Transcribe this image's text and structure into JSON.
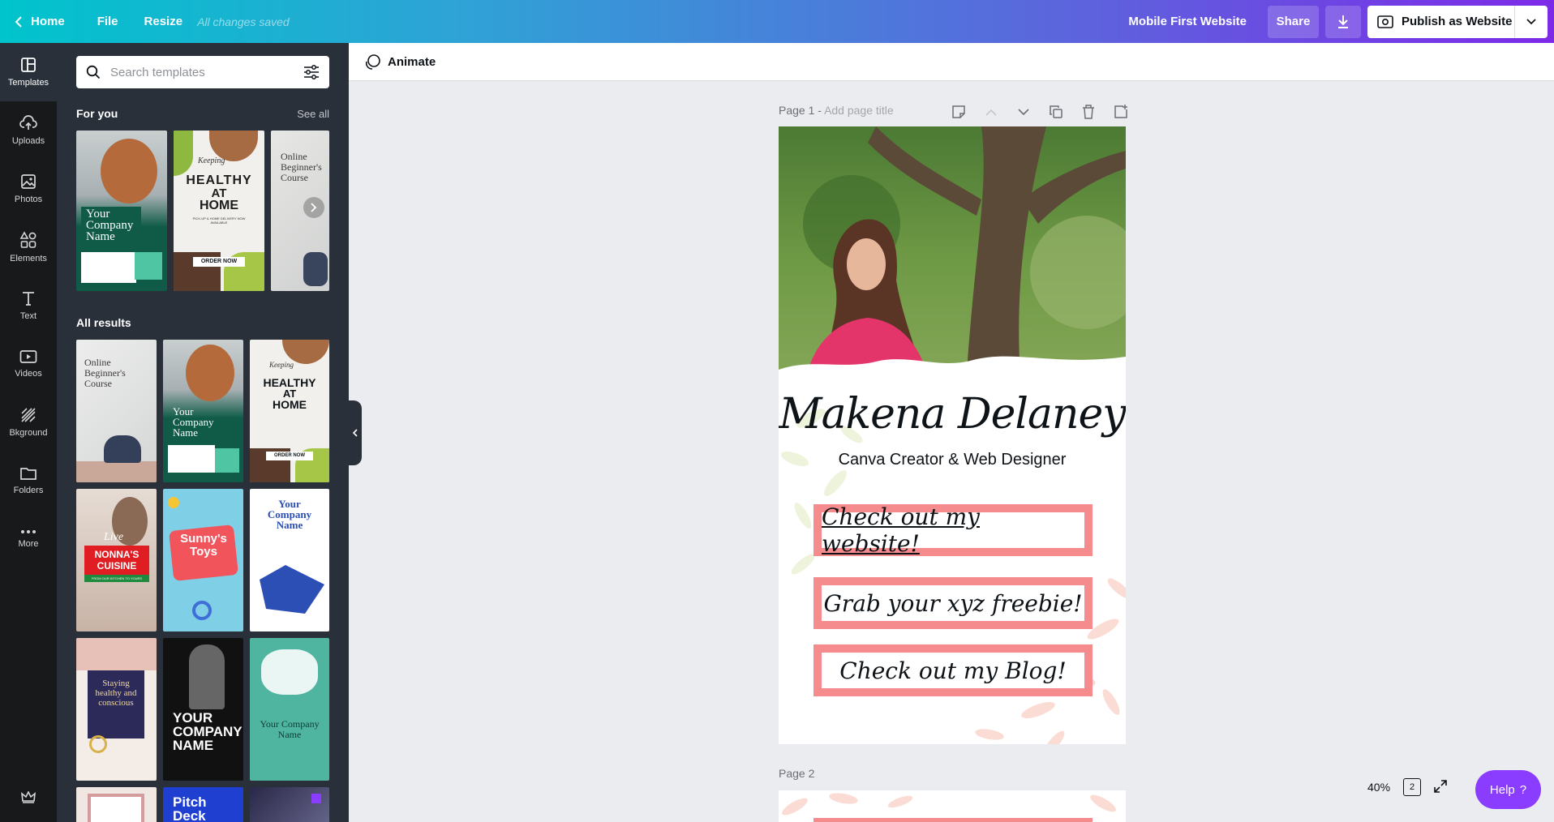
{
  "topbar": {
    "home_label": "Home",
    "file_label": "File",
    "resize_label": "Resize",
    "saved_status": "All changes saved",
    "design_title": "Mobile First Website",
    "share_label": "Share",
    "publish_label": "Publish as Website"
  },
  "rail": {
    "items": [
      {
        "label": "Templates",
        "icon": "templates-icon"
      },
      {
        "label": "Uploads",
        "icon": "upload-icon"
      },
      {
        "label": "Photos",
        "icon": "photo-icon"
      },
      {
        "label": "Elements",
        "icon": "elements-icon"
      },
      {
        "label": "Text",
        "icon": "text-icon"
      },
      {
        "label": "Videos",
        "icon": "video-icon"
      },
      {
        "label": "Bkground",
        "icon": "background-icon"
      },
      {
        "label": "Folders",
        "icon": "folder-icon"
      },
      {
        "label": "More",
        "icon": "more-icon"
      }
    ]
  },
  "panel": {
    "search_placeholder": "Search templates",
    "for_you_title": "For you",
    "see_all_label": "See all",
    "all_results_title": "All results",
    "thumbs": {
      "company_name": "Your Company Name",
      "keeping": "Keeping",
      "healthy": "HEALTHY",
      "at": "AT",
      "home": "HOME",
      "pickup": "PICK-UP & HOME DELIVERY NOW AVAILABLE",
      "order_now": "ORDER NOW",
      "online_course": "Online Beginner's Course",
      "live": "Live",
      "nonnas": "NONNA'S CUISINE",
      "from_kitchen": "FROM OUR KITCHEN TO YOURS",
      "sunnys": "Sunny's Toys",
      "staying": "Staying healthy and conscious",
      "your_company_caps": "YOUR COMPANY NAME",
      "pitch_deck": "Pitch Deck"
    }
  },
  "toolbar": {
    "animate_label": "Animate"
  },
  "page1": {
    "label": "Page 1 -",
    "add_title": "Add page title",
    "name": "Makena Delaney",
    "subtitle": "Canva Creator & Web Designer",
    "cta1": "Check out my website!",
    "cta2": "Grab your xyz freebie!",
    "cta3": "Check out my Blog!"
  },
  "page2": {
    "label": "Page 2"
  },
  "footer": {
    "zoom": "40%",
    "page_count": "2",
    "help_label": "Help",
    "help_glyph": "?"
  },
  "colors": {
    "accent_purple": "#8b3dff",
    "cta_border": "#f58b8d",
    "panel_bg": "#293039",
    "rail_bg": "#18191b"
  }
}
